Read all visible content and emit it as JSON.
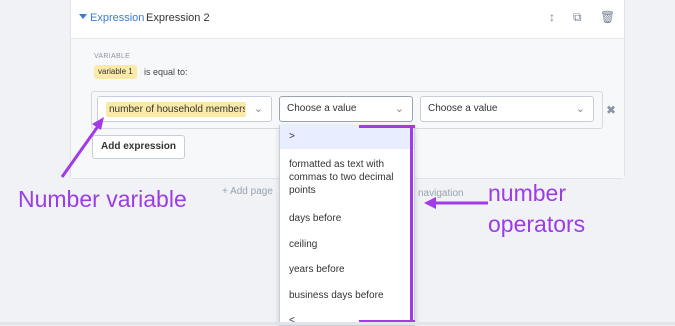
{
  "header": {
    "expression_link": "Expression",
    "expression_title": "Expression 2"
  },
  "body": {
    "variable_caption": "VARIABLE",
    "variable_pill": "variable 1",
    "equal_text": "is equal to:"
  },
  "condition": {
    "variable_value": "number of household members",
    "operator_placeholder": "Choose a value",
    "value_placeholder": "Choose a value"
  },
  "buttons": {
    "add_expression": "Add expression",
    "add_page": "Add page",
    "navigation_fragment": "navigation"
  },
  "dropdown": {
    "options": [
      ">",
      "formatted as text with commas to two decimal points",
      "days before",
      "ceiling",
      "years before",
      "business days before",
      "<"
    ]
  },
  "annotations": {
    "left": "Number variable",
    "right_line1": "number",
    "right_line2": "operators"
  },
  "colors": {
    "accent": "#3a7bd5",
    "highlight": "#fbe9a8",
    "annotation": "#a23ae8"
  }
}
